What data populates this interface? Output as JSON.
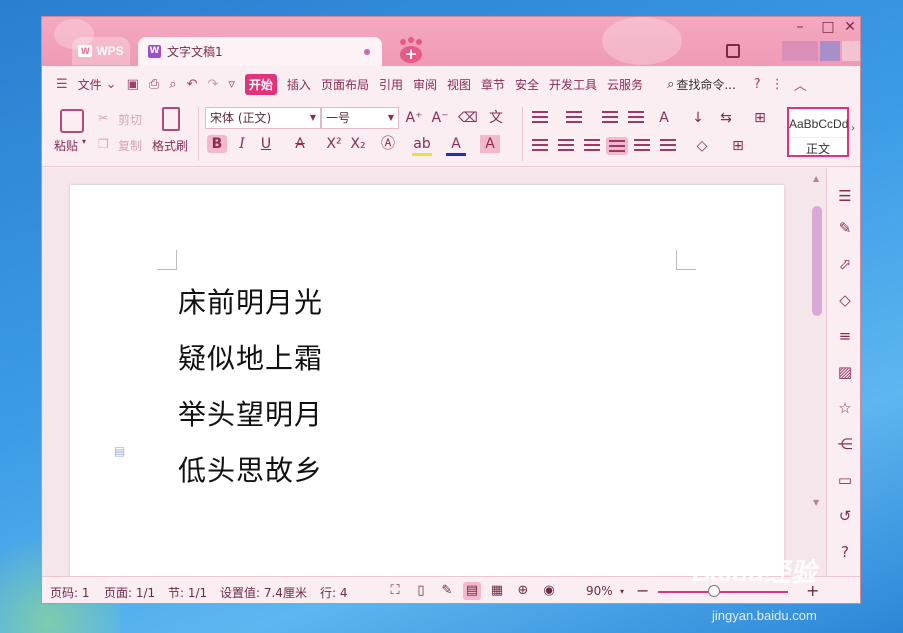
{
  "titlebar": {
    "wps_tab": "WPS",
    "doc_tab": "文字文稿1",
    "colors": {
      "accent": "#e0347a",
      "titlebar": "#f09ab5"
    }
  },
  "menu": {
    "file": "文件",
    "items": [
      "开始",
      "插入",
      "页面布局",
      "引用",
      "审阅",
      "视图",
      "章节",
      "安全",
      "开发工具",
      "云服务"
    ],
    "search": "查找命令..."
  },
  "ribbon": {
    "paste": "粘贴",
    "cut": "剪切",
    "copy": "复制",
    "format_painter": "格式刷",
    "font_name": "宋体 (正文)",
    "font_size": "一号",
    "style_sample": "AaBbCcDd",
    "style_name": "正文"
  },
  "document": {
    "lines": [
      "床前明月光",
      "疑似地上霜",
      "举头望明月",
      "低头思故乡"
    ]
  },
  "status": {
    "page_num": "页码: 1",
    "page": "页面: 1/1",
    "section": "节: 1/1",
    "setting": "设置值: 7.4厘米",
    "row": "行: 4",
    "zoom": "90%",
    "zoom_fraction": 0.43
  },
  "watermark": {
    "brand": "Baidu经验",
    "url": "jingyan.baidu.com"
  }
}
